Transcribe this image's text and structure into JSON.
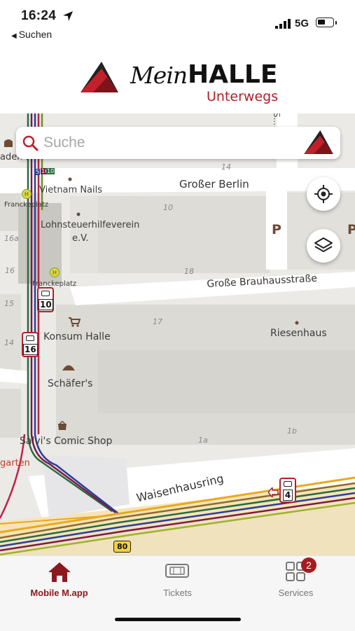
{
  "status_bar": {
    "time": "16:24",
    "back_label": "Suchen",
    "network": "5G",
    "battery_level": 0.55
  },
  "header": {
    "brand_script": "Mein",
    "brand_name": "HALLE",
    "brand_sub": "Unterwegs"
  },
  "search": {
    "placeholder": "Suche"
  },
  "map": {
    "streets": {
      "grosser_berlin": "Großer Berlin",
      "grosse_brauhausstrasse": "Große Brauhausstraße",
      "waisenhausring": "Waisenhausring",
      "vertical_top": "S..."
    },
    "pois": {
      "vietnam_nails": "Vietnam Nails",
      "feuerhilfeverein": "Lohn- feuerhilfeverein e.V.",
      "feuerhilfeverein_line1": "Lohnsteuerhilfeverein",
      "feuerhilfeverein_line2": "e.V.",
      "konsum_halle": "Konsum Halle",
      "schaefers": "Schäfer's",
      "salvis": "Salvi's Comic Shop",
      "riesenhaus": "Riesenhaus",
      "baden": "aden H",
      "garten": "garten"
    },
    "stops": {
      "franckeplatz_top": "Franckeplatz",
      "franckeplatz_bottom": "Franckeplatz"
    },
    "house_numbers": [
      "14",
      "10",
      "18",
      "17",
      "1b",
      "1a",
      "16a",
      "16",
      "15",
      "14"
    ],
    "parking": "P",
    "route_sign": "80",
    "tram_lines": [
      "10",
      "16",
      "4"
    ],
    "line_tags": [
      "5",
      "16",
      "10"
    ]
  },
  "tabs": [
    {
      "label": "Mobile M.app",
      "active": true
    },
    {
      "label": "Tickets",
      "active": false
    },
    {
      "label": "Services",
      "active": false,
      "badge": "2"
    }
  ],
  "colors": {
    "brand_red": "#b0202a",
    "tab_active": "#8b1a1f",
    "badge": "#a51c1f"
  }
}
